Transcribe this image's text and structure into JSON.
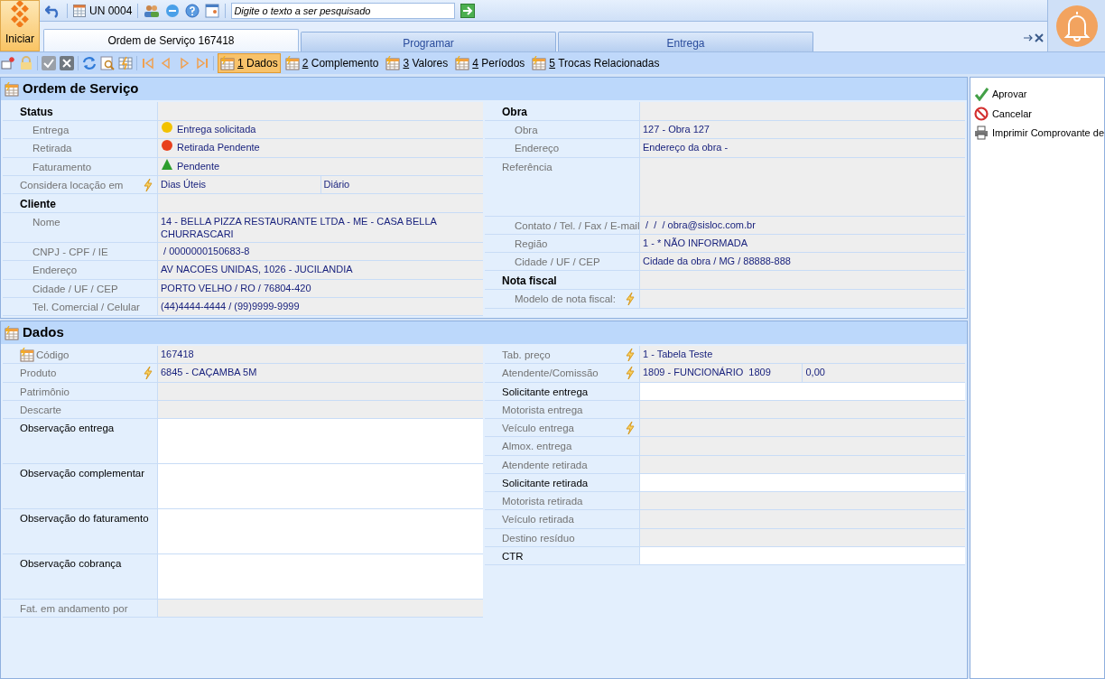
{
  "start_button": {
    "label": "Iniciar"
  },
  "top_bar": {
    "unit": "UN 0004",
    "search": {
      "placeholder": "Digite o texto a ser pesquisado"
    }
  },
  "doc_tabs": [
    {
      "label": "Ordem de Serviço 167418",
      "selected": true
    },
    {
      "label": "Programar",
      "selected": false
    },
    {
      "label": "Entrega",
      "selected": false
    }
  ],
  "nav_tabs": [
    {
      "number": "1",
      "label": "Dados",
      "selected": true
    },
    {
      "number": "2",
      "label": "Complemento",
      "selected": false
    },
    {
      "number": "3",
      "label": "Valores",
      "selected": false
    },
    {
      "number": "4",
      "label": "Períodos",
      "selected": false
    },
    {
      "number": "5",
      "label": "Trocas Relacionadas",
      "selected": false
    }
  ],
  "sections": [
    {
      "title": "Ordem de Serviço",
      "left": [
        {
          "kind": "group",
          "label": "Status"
        },
        {
          "kind": "subfield",
          "label": "Entrega",
          "values": [
            "Entrega solicitada"
          ],
          "status": {
            "kind": "circle",
            "color": "#f2c200"
          }
        },
        {
          "kind": "subfield",
          "label": "Retirada",
          "values": [
            "Retirada Pendente"
          ],
          "status": {
            "kind": "circle",
            "color": "#e8401c"
          }
        },
        {
          "kind": "subfield",
          "label": "Faturamento",
          "values": [
            "Pendente"
          ],
          "status": {
            "kind": "triangle",
            "color": "#2e9e2e"
          }
        },
        {
          "kind": "field",
          "label": "Considera locação em",
          "lookup": true,
          "values": [
            "Dias Úteis",
            "Diário"
          ]
        },
        {
          "kind": "group",
          "label": "Cliente"
        },
        {
          "kind": "subfield",
          "label": "Nome",
          "values": [
            "14 - BELLA PIZZA RESTAURANTE LTDA - ME - CASA BELLA CHURRASCARI"
          ]
        },
        {
          "kind": "subfield",
          "label": "CNPJ - CPF / IE",
          "values": [
            " / 0000000150683-8"
          ]
        },
        {
          "kind": "subfield",
          "label": "Endereço",
          "values": [
            "AV NACOES UNIDAS, 1026 - JUCILANDIA"
          ]
        },
        {
          "kind": "subfield",
          "label": "Cidade / UF / CEP",
          "values": [
            "PORTO VELHO / RO / 76804-420"
          ]
        },
        {
          "kind": "subfield",
          "label": "Tel. Comercial / Celular",
          "values": [
            "(44)4444-4444 / (99)9999-9999"
          ]
        }
      ],
      "right": [
        {
          "kind": "group",
          "label": "Obra"
        },
        {
          "kind": "subfield",
          "label": "Obra",
          "values": [
            "127 - Obra 127"
          ]
        },
        {
          "kind": "subfield",
          "label": "Endereço",
          "values": [
            "Endereço da obra -"
          ]
        },
        {
          "kind": "area",
          "label": "Referência"
        },
        {
          "kind": "subfield",
          "label": "Contato / Tel. / Fax / E-mail",
          "values": [
            " /  /  / obra@sisloc.com.br"
          ]
        },
        {
          "kind": "subfield",
          "label": "Região",
          "values": [
            "1 - * NÃO INFORMADA"
          ]
        },
        {
          "kind": "subfield",
          "label": "Cidade / UF / CEP",
          "values": [
            "Cidade da obra / MG / 88888-888"
          ]
        },
        {
          "kind": "group",
          "label": "Nota fiscal"
        },
        {
          "kind": "subfield",
          "label": "Modelo de nota fiscal:",
          "lookup": true
        }
      ]
    },
    {
      "title": "Dados",
      "left": [
        {
          "kind": "code",
          "label": "Código",
          "values": [
            "167418"
          ]
        },
        {
          "kind": "field",
          "label": "Produto",
          "lookup": true,
          "values": [
            "6845 - CAÇAMBA 5M"
          ]
        },
        {
          "kind": "field",
          "label": "Patrimônio"
        },
        {
          "kind": "field",
          "label": "Descarte"
        },
        {
          "kind": "memo",
          "label": "Observação entrega"
        },
        {
          "kind": "memo",
          "label": "Observação complementar"
        },
        {
          "kind": "memo",
          "label": "Observação do faturamento"
        },
        {
          "kind": "memo",
          "label": "Observação cobrança"
        },
        {
          "kind": "field",
          "label": "Fat. em andamento por"
        }
      ],
      "right": [
        {
          "kind": "field",
          "label": "Tab. preço",
          "lookup": true,
          "values": [
            "1 - Tabela Teste"
          ]
        },
        {
          "kind": "field",
          "label": "Atendente/Comissão",
          "lookup": true,
          "values": [
            "1809 - FUNCIONÁRIO  1809",
            "0,00"
          ]
        },
        {
          "kind": "editable",
          "label": "Solicitante entrega"
        },
        {
          "kind": "field",
          "label": "Motorista entrega"
        },
        {
          "kind": "field",
          "label": "Veículo entrega",
          "lookup": true
        },
        {
          "kind": "field",
          "label": "Almox. entrega"
        },
        {
          "kind": "field",
          "label": "Atendente retirada"
        },
        {
          "kind": "editable",
          "label": "Solicitante retirada"
        },
        {
          "kind": "field",
          "label": "Motorista retirada"
        },
        {
          "kind": "field",
          "label": "Veículo retirada"
        },
        {
          "kind": "field",
          "label": "Destino resíduo"
        },
        {
          "kind": "editable",
          "label": "CTR"
        }
      ]
    }
  ],
  "actions": [
    {
      "kind": "approve",
      "label": "Aprovar"
    },
    {
      "kind": "cancel",
      "label": "Cancelar"
    },
    {
      "kind": "print",
      "label": "Imprimir Comprovante de"
    }
  ]
}
